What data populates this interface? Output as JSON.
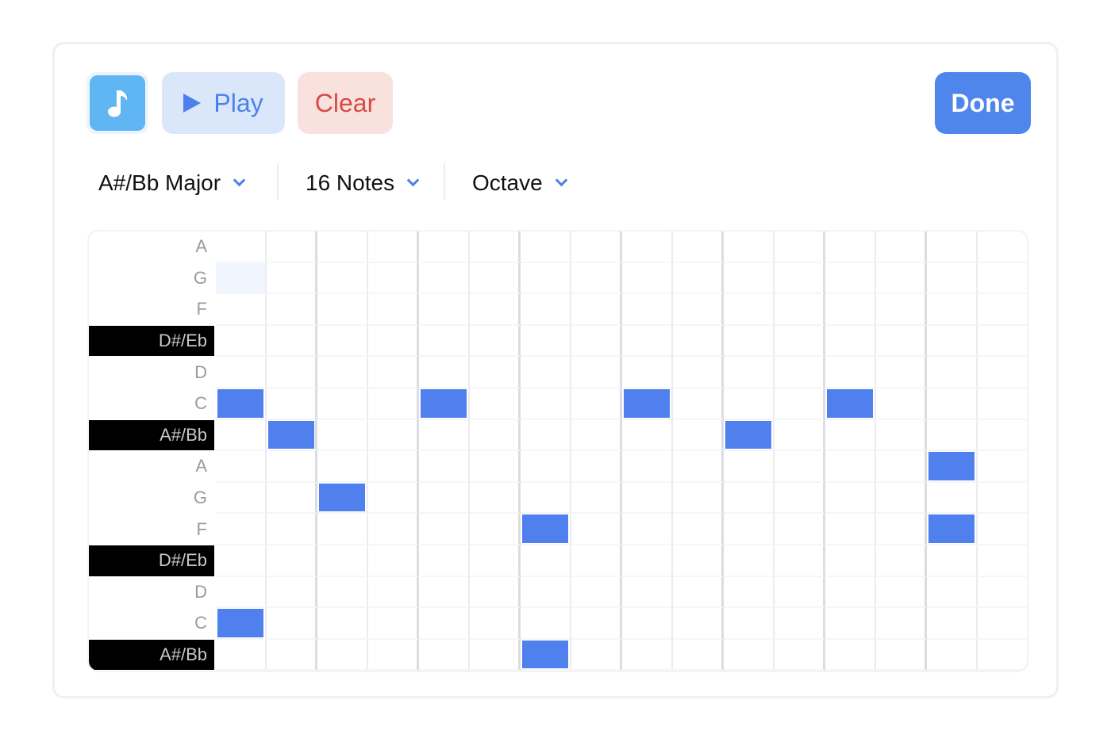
{
  "toolbar": {
    "music_icon": "music-note-icon",
    "play_icon": "play-triangle-icon",
    "play_label": "Play",
    "clear_label": "Clear",
    "done_label": "Done"
  },
  "selectors": {
    "scale": "A#/Bb Major",
    "length": "16 Notes",
    "octave": "Octave"
  },
  "piano_roll": {
    "columns": 16,
    "hover_cell": {
      "row": 1,
      "step": 0
    },
    "rows": [
      {
        "label": "A",
        "black": false
      },
      {
        "label": "G",
        "black": false
      },
      {
        "label": "F",
        "black": false
      },
      {
        "label": "D#/Eb",
        "black": true
      },
      {
        "label": "D",
        "black": false
      },
      {
        "label": "C",
        "black": false
      },
      {
        "label": "A#/Bb",
        "black": true
      },
      {
        "label": "A",
        "black": false
      },
      {
        "label": "G",
        "black": false
      },
      {
        "label": "F",
        "black": false
      },
      {
        "label": "D#/Eb",
        "black": true
      },
      {
        "label": "D",
        "black": false
      },
      {
        "label": "C",
        "black": false
      },
      {
        "label": "A#/Bb",
        "black": true
      }
    ],
    "notes": [
      {
        "row": 5,
        "step": 0
      },
      {
        "row": 12,
        "step": 0
      },
      {
        "row": 6,
        "step": 1
      },
      {
        "row": 8,
        "step": 2
      },
      {
        "row": 5,
        "step": 4
      },
      {
        "row": 9,
        "step": 6
      },
      {
        "row": 13,
        "step": 6
      },
      {
        "row": 5,
        "step": 8
      },
      {
        "row": 6,
        "step": 10
      },
      {
        "row": 5,
        "step": 12
      },
      {
        "row": 7,
        "step": 14
      },
      {
        "row": 9,
        "step": 14
      }
    ],
    "colors": {
      "note": "#4f80ee",
      "black_key": "#000000"
    }
  }
}
